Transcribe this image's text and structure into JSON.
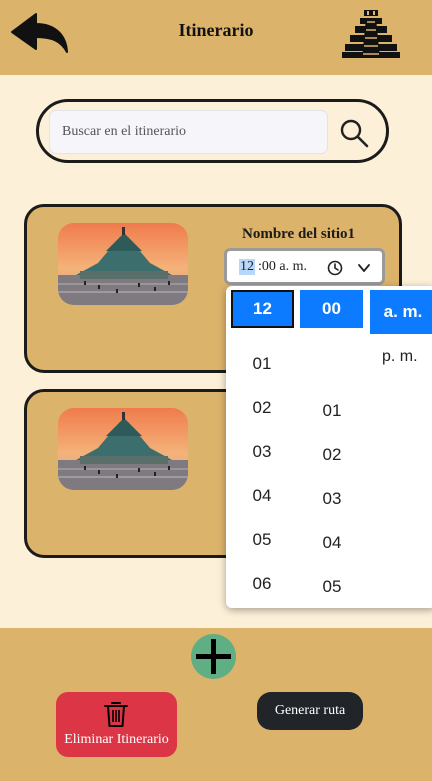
{
  "header": {
    "title": "Itinerario",
    "back_icon": "back-arrow-icon",
    "logo_icon": "pyramid-icon"
  },
  "search": {
    "placeholder": "Buscar en el itinerario",
    "icon": "search-icon"
  },
  "itinerary": [
    {
      "site_name": "Nombre del sitio1",
      "image": "basilica-photo"
    },
    {
      "site_name": "",
      "image": "basilica-photo"
    }
  ],
  "time_input": {
    "hour": "12",
    "rest": ":00 a. m.",
    "clock_icon": "clock-icon",
    "caret_icon": "chevron-down-icon"
  },
  "time_picker": {
    "selected_hour": "12",
    "selected_minute": "00",
    "selected_period": "a. m.",
    "hours": [
      "01",
      "02",
      "03",
      "04",
      "05",
      "06"
    ],
    "minutes": [
      "01",
      "02",
      "03",
      "04",
      "05"
    ],
    "other_period": "p. m."
  },
  "footer": {
    "add_icon": "plus-icon",
    "delete_label": "Eliminar Itinerario",
    "delete_icon": "trash-icon",
    "route_label": "Generar ruta"
  },
  "colors": {
    "header_bg": "#dcb36b",
    "page_bg": "#fdf0d8",
    "primary": "#0d7bff",
    "danger": "#dc3545",
    "dark": "#212529",
    "add_green": "#5fae84"
  }
}
